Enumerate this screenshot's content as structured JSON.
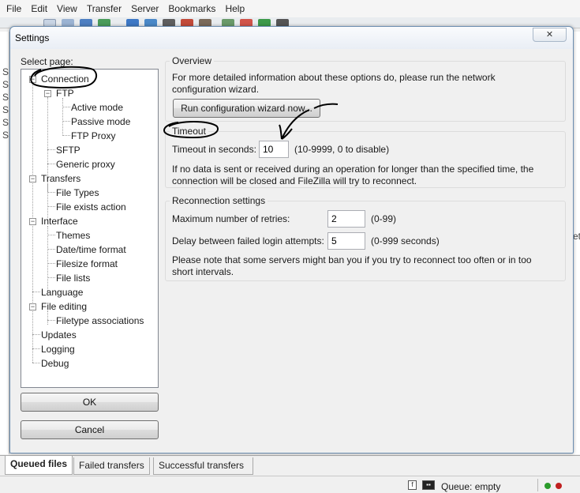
{
  "menu": [
    "File",
    "Edit",
    "View",
    "Transfer",
    "Server",
    "Bookmarks",
    "Help"
  ],
  "background": {
    "left_chars": [
      "S",
      "S",
      "S",
      "S",
      "S",
      "S"
    ],
    "right_chars": [
      "et"
    ]
  },
  "dialog": {
    "title": "Settings",
    "close_glyph": "✕",
    "select_page_label": "Select page:",
    "tree": {
      "connection": "Connection",
      "ftp": "FTP",
      "active_mode": "Active mode",
      "passive_mode": "Passive mode",
      "ftp_proxy": "FTP Proxy",
      "sftp": "SFTP",
      "generic_proxy": "Generic proxy",
      "transfers": "Transfers",
      "file_types": "File Types",
      "file_exists_action": "File exists action",
      "interface": "Interface",
      "themes": "Themes",
      "date_time_format": "Date/time format",
      "filesize_format": "Filesize format",
      "file_lists": "File lists",
      "language": "Language",
      "file_editing": "File editing",
      "filetype_associations": "Filetype associations",
      "updates": "Updates",
      "logging": "Logging",
      "debug": "Debug"
    },
    "ok_label": "OK",
    "cancel_label": "Cancel",
    "overview": {
      "title": "Overview",
      "text": "For more detailed information about these options do, please run the network configuration wizard.",
      "wizard_button": "Run configuration wizard now..."
    },
    "timeout": {
      "title": "Timeout",
      "label": "Timeout in seconds:",
      "value": "10",
      "hint": "(10-9999, 0 to disable)",
      "note": "If no data is sent or received during an operation for longer than the specified time, the connection will be closed and FileZilla will try to reconnect."
    },
    "reconnection": {
      "title": "Reconnection settings",
      "retries_label": "Maximum number of retries:",
      "retries_value": "2",
      "retries_hint": "(0-99)",
      "delay_label": "Delay between failed login attempts:",
      "delay_value": "5",
      "delay_hint": "(0-999 seconds)",
      "note": "Please note that some servers might ban you if you try to reconnect too often or in too short intervals."
    }
  },
  "bottom_tabs": {
    "queued": "Queued files",
    "failed": "Failed transfers",
    "successful": "Successful transfers"
  },
  "status": {
    "queue": "Queue: empty"
  },
  "colors": {
    "led_green": "#2a9a2a",
    "led_red": "#c02020",
    "annotation_ink": "#000000"
  }
}
